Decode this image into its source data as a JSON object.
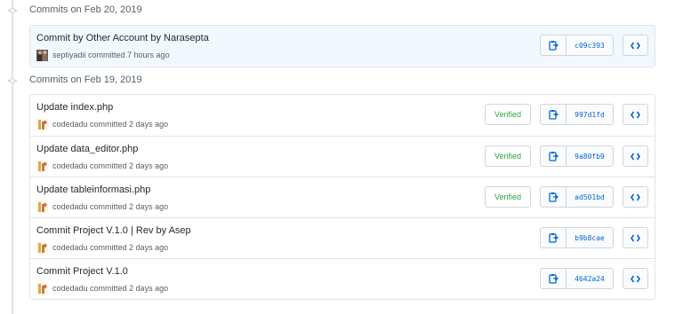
{
  "groups": [
    {
      "header": "Commits on Feb 20, 2019",
      "commits": [
        {
          "message": "Commit by Other Account by Narasepta",
          "meta": "septiyadii committed 7 hours ago",
          "verified": "",
          "sha": "c09c393",
          "highlight": true
        }
      ]
    },
    {
      "header": "Commits on Feb 19, 2019",
      "commits": [
        {
          "message": "Update index.php",
          "meta": "codedadu committed 2 days ago",
          "verified": "Verified",
          "sha": "997d1fd"
        },
        {
          "message": "Update data_editor.php",
          "meta": "codedadu committed 2 days ago",
          "verified": "Verified",
          "sha": "9a80fb9"
        },
        {
          "message": "Update tableinformasi.php",
          "meta": "codedadu committed 2 days ago",
          "verified": "Verified",
          "sha": "ad501bd"
        },
        {
          "message": "Commit Project V.1.0 | Rev by Asep",
          "meta": "codedadu committed 2 days ago",
          "verified": "",
          "sha": "b9b8cae"
        },
        {
          "message": "Commit Project V.1.0",
          "meta": "codedadu committed 2 days ago",
          "verified": "",
          "sha": "4642a24"
        }
      ]
    }
  ],
  "icons": {
    "timeline_dot": "commit-dot-icon",
    "copy": "clipboard-icon",
    "browse": "code-icon"
  },
  "colors": {
    "sha_link": "#0366d6",
    "verified": "#28a745",
    "highlight_row": "#f1f8ff"
  }
}
